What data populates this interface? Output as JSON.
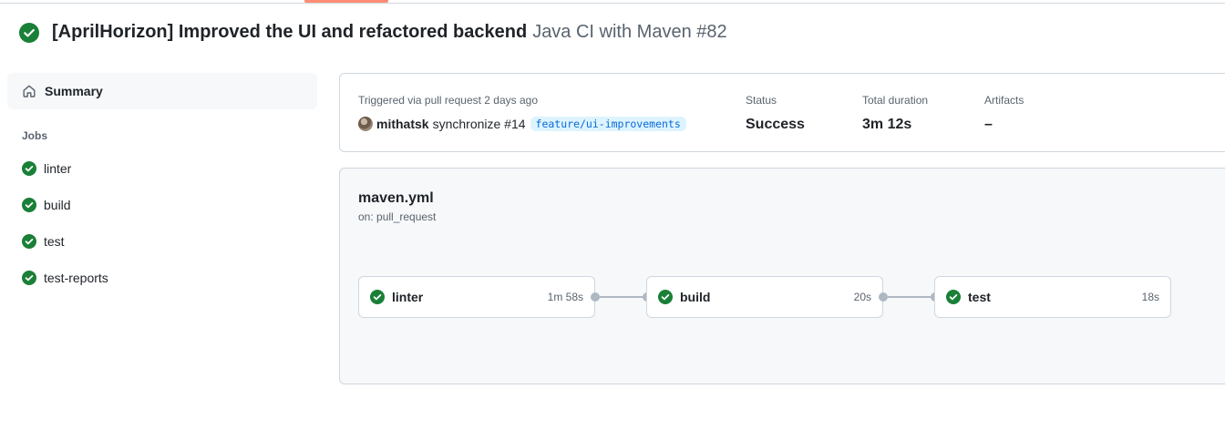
{
  "header": {
    "title": "[AprilHorizon] Improved the UI and refactored backend",
    "workflow_run": "Java CI with Maven #82",
    "status_icon": "check-circle-fill-icon",
    "status_color": "#1a7f37"
  },
  "sidebar": {
    "summary_label": "Summary",
    "summary_icon": "home-icon",
    "jobs_heading": "Jobs",
    "jobs": [
      {
        "label": "linter",
        "icon": "check-circle-fill-icon"
      },
      {
        "label": "build",
        "icon": "check-circle-fill-icon"
      },
      {
        "label": "test",
        "icon": "check-circle-fill-icon"
      },
      {
        "label": "test-reports",
        "icon": "check-circle-fill-icon"
      }
    ]
  },
  "summary": {
    "trigger_label": "Triggered via pull request 2 days ago",
    "actor": "mithatsk",
    "trigger_action": "synchronize #14",
    "branch": "feature/ui-improvements",
    "status_label": "Status",
    "status_value": "Success",
    "duration_label": "Total duration",
    "duration_value": "3m 12s",
    "artifacts_label": "Artifacts",
    "artifacts_value": "–"
  },
  "workflow": {
    "file": "maven.yml",
    "on": "on: pull_request",
    "jobs": [
      {
        "name": "linter",
        "duration": "1m 58s"
      },
      {
        "name": "build",
        "duration": "20s"
      },
      {
        "name": "test",
        "duration": "18s"
      }
    ]
  },
  "colors": {
    "success": "#1a7f37",
    "tab_accent": "#fd8c73",
    "branch_bg": "#ddf4ff",
    "branch_fg": "#0969da"
  }
}
